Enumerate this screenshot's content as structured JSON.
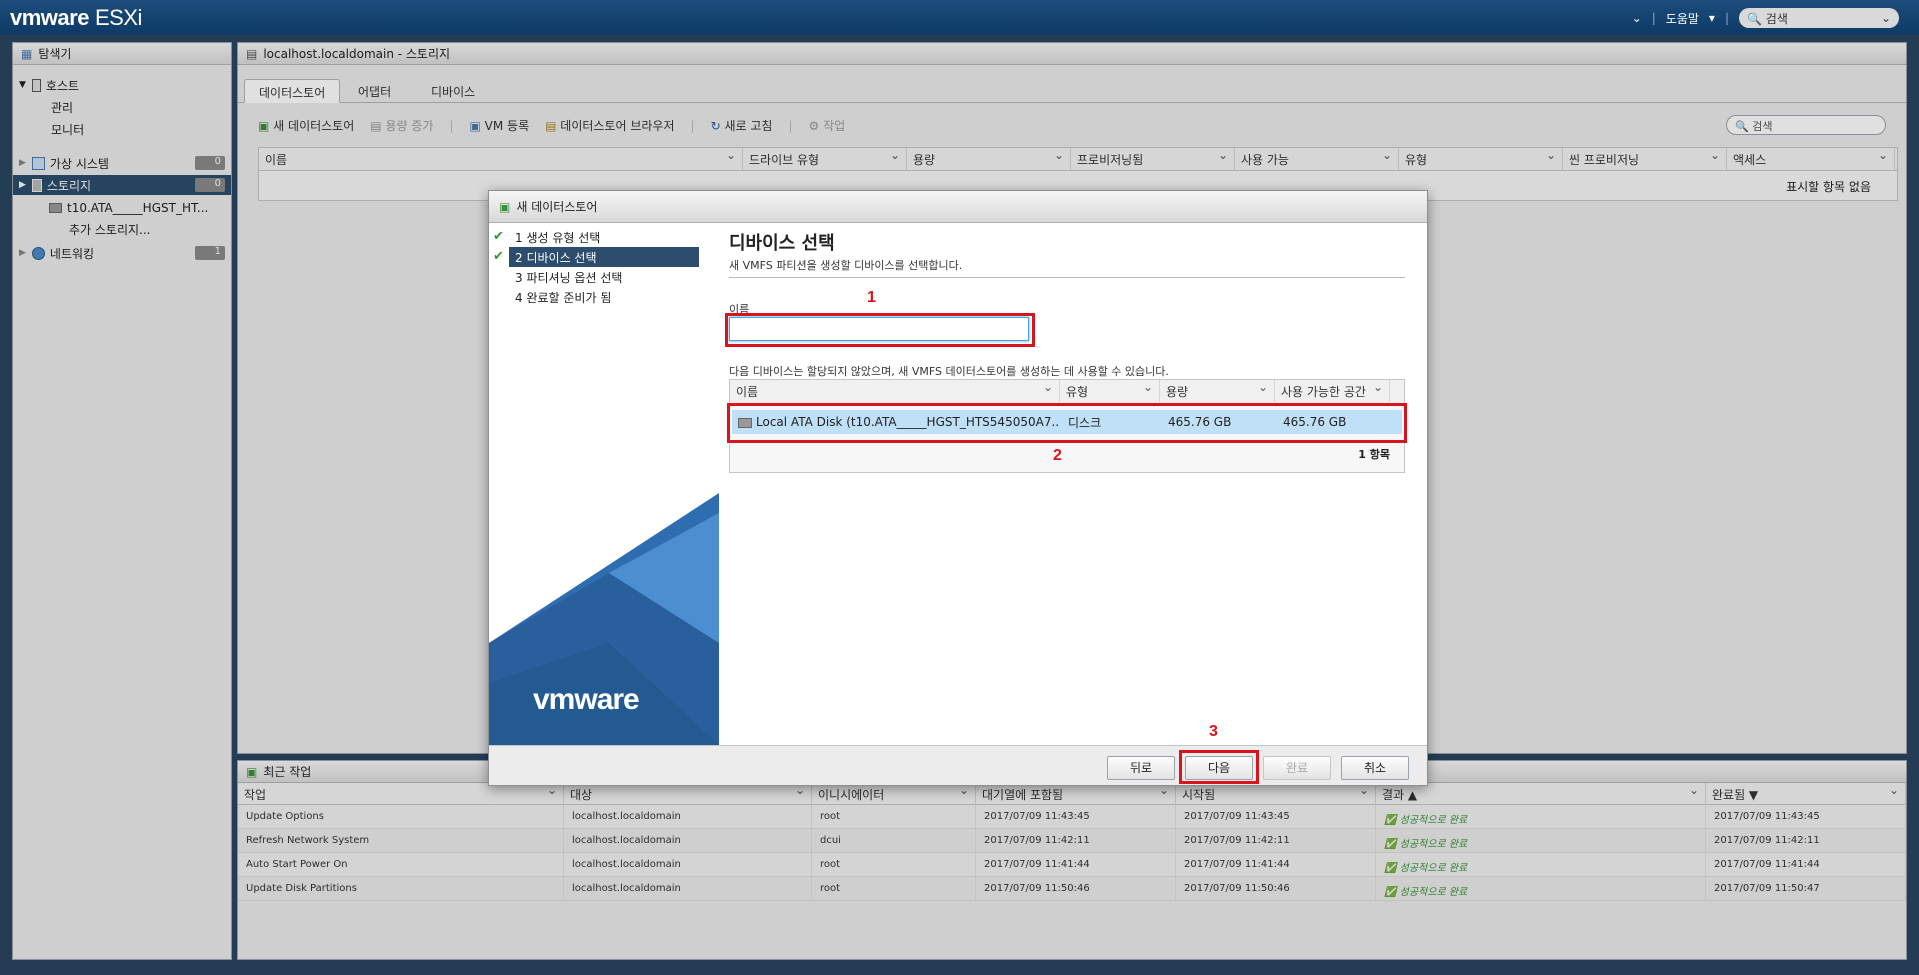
{
  "topbar": {
    "brand": "vmware",
    "product": "ESXi",
    "help": "도움말",
    "search_placeholder": "검색"
  },
  "navigator": {
    "title": "탐색기",
    "items": [
      {
        "label": "호스트"
      },
      {
        "label": "관리"
      },
      {
        "label": "모니터"
      },
      {
        "label": "가상 시스템",
        "badge": "0"
      },
      {
        "label": "스토리지",
        "badge": "0"
      },
      {
        "label": "t10.ATA_____HGST_HT..."
      },
      {
        "label": "추가 스토리지..."
      },
      {
        "label": "네트워킹",
        "badge": "1"
      }
    ]
  },
  "main": {
    "breadcrumb": "localhost.localdomain - 스토리지",
    "tabs": [
      "데이터스토어",
      "어댑터",
      "디바이스"
    ],
    "toolbar": {
      "new_datastore": "새 데이터스토어",
      "increase_capacity": "용량 증가",
      "register_vm": "VM 등록",
      "datastore_browser": "데이터스토어 브라우저",
      "refresh": "새로 고침",
      "actions": "작업",
      "search_placeholder": "검색"
    },
    "columns": [
      "이름",
      "드라이브 유형",
      "용량",
      "프로비저닝됨",
      "사용 가능",
      "유형",
      "씬 프로비저닝",
      "액세스"
    ],
    "empty_text": "표시할 항목 없음"
  },
  "tasks": {
    "title": "최근 작업",
    "columns": [
      "작업",
      "대상",
      "이니시에이터",
      "대기열에 포함됨",
      "시작됨",
      "결과 ▲",
      "완료됨 ▼"
    ],
    "rows": [
      {
        "task": "Update Options",
        "target": "localhost.localdomain",
        "initiator": "root",
        "queued": "2017/07/09 11:43:45",
        "started": "2017/07/09 11:43:45",
        "result": "성공적으로 완료",
        "completed": "2017/07/09 11:43:45"
      },
      {
        "task": "Refresh Network System",
        "target": "localhost.localdomain",
        "initiator": "dcui",
        "queued": "2017/07/09 11:42:11",
        "started": "2017/07/09 11:42:11",
        "result": "성공적으로 완료",
        "completed": "2017/07/09 11:42:11"
      },
      {
        "task": "Auto Start Power On",
        "target": "localhost.localdomain",
        "initiator": "root",
        "queued": "2017/07/09 11:41:44",
        "started": "2017/07/09 11:41:44",
        "result": "성공적으로 완료",
        "completed": "2017/07/09 11:41:44"
      },
      {
        "task": "Update Disk Partitions",
        "target": "localhost.localdomain",
        "initiator": "root",
        "queued": "2017/07/09 11:50:46",
        "started": "2017/07/09 11:50:46",
        "result": "성공적으로 완료",
        "completed": "2017/07/09 11:50:47"
      }
    ]
  },
  "dialog": {
    "title": "새 데이터스토어",
    "steps": [
      "1 생성 유형 선택",
      "2 디바이스 선택",
      "3 파티셔닝 옵션 선택",
      "4 완료할 준비가 됨"
    ],
    "logo": "vmware",
    "heading": "디바이스 선택",
    "subheading": "새 VMFS 파티션을 생성할 디바이스를 선택합니다.",
    "name_label": "이름",
    "name_value": "",
    "device_note": "다음 디바이스는 할당되지 않았으며, 새 VMFS 데이터스토어를 생성하는 데 사용할 수 있습니다.",
    "device_columns": [
      "이름",
      "유형",
      "용량",
      "사용 가능한 공간"
    ],
    "device_row": {
      "name": "Local ATA Disk (t10.ATA_____HGST_HTS545050A7...",
      "type": "디스크",
      "capacity": "465.76 GB",
      "free": "465.76 GB"
    },
    "item_count": "1 항목",
    "buttons": {
      "back": "뒤로",
      "next": "다음",
      "finish": "완료",
      "cancel": "취소"
    }
  },
  "annotations": [
    "1",
    "2",
    "3"
  ],
  "colors": {
    "accent": "#d8141c",
    "selection": "#2c4d6e",
    "topbar": "#0d3a66"
  }
}
